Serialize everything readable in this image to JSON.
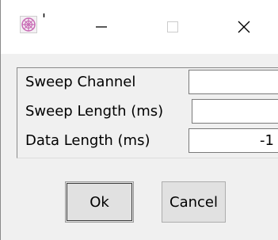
{
  "window": {
    "title": "'",
    "icon": "app-icon",
    "controls": {
      "minimize_icon": "minimize-icon",
      "maximize_icon": "maximize-icon",
      "close_icon": "close-icon"
    }
  },
  "fields": [
    {
      "label": "Sweep Channel",
      "value": "",
      "placeholder": ""
    },
    {
      "label": "Sweep Length (ms)",
      "value": "",
      "placeholder": ""
    },
    {
      "label": "Data Length (ms)",
      "value": "-1",
      "placeholder": ""
    }
  ],
  "buttons": {
    "ok_label": "Ok",
    "cancel_label": "Cancel"
  },
  "colors": {
    "dialog_background": "#f0f0f0",
    "titlebar_background": "#ffffff",
    "button_face": "#e1e1e1",
    "button_border": "#adadad",
    "input_background": "#ffffff"
  }
}
